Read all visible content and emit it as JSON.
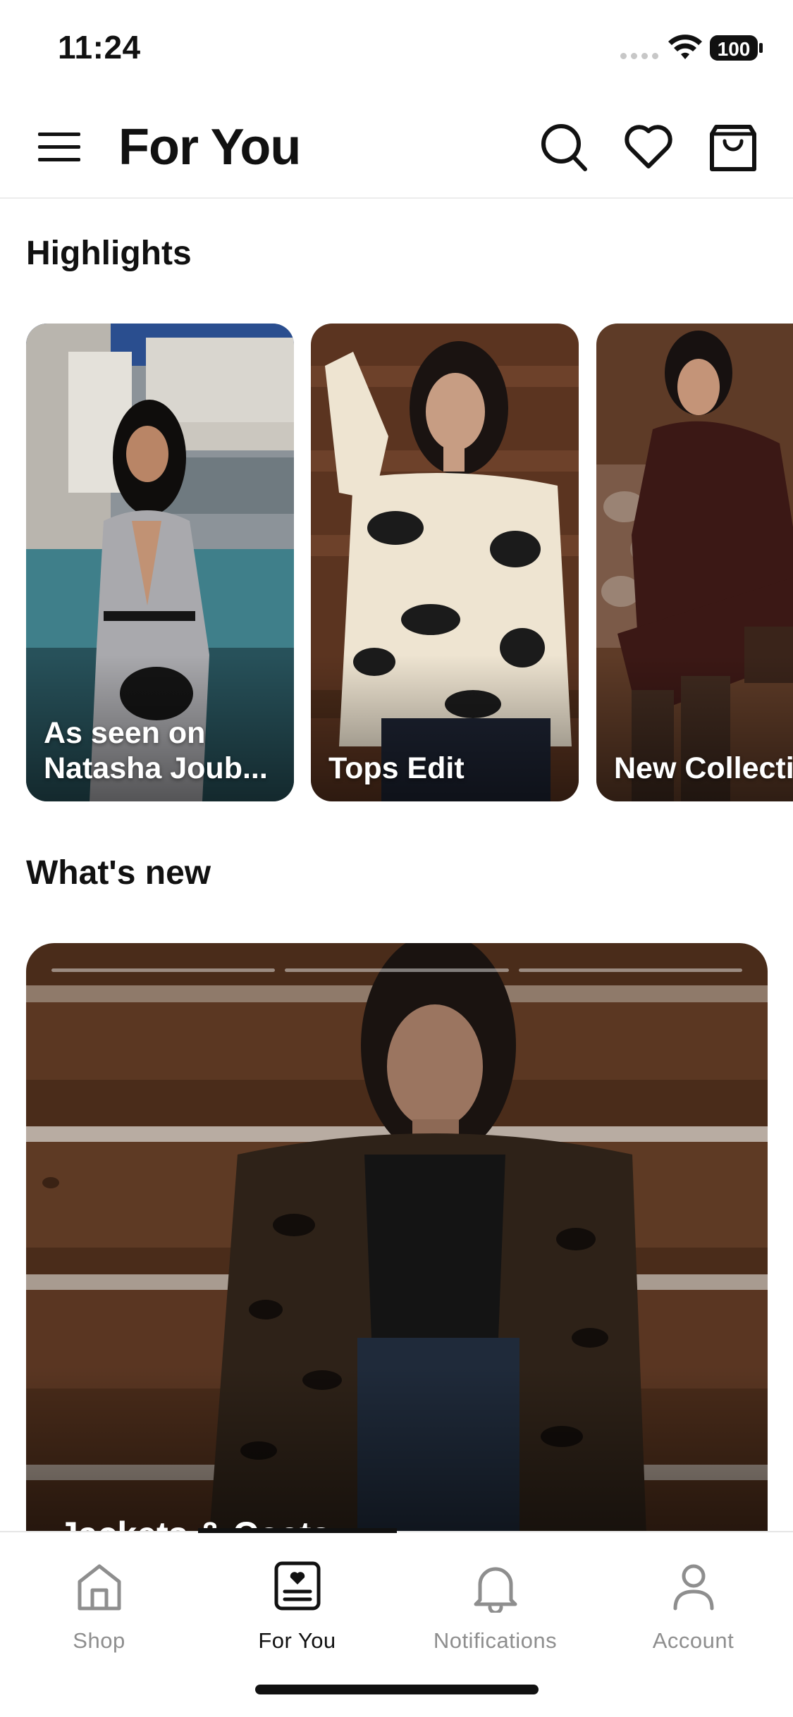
{
  "status_bar": {
    "time": "11:24",
    "battery": "100"
  },
  "header": {
    "title": "For You"
  },
  "highlights": {
    "title": "Highlights",
    "items": [
      {
        "label": "As seen on\nNatasha Joub..."
      },
      {
        "label": "Tops Edit"
      },
      {
        "label": "New Collecti"
      }
    ]
  },
  "whats_new": {
    "title": "What's new",
    "story_label": "Jackets & Coats"
  },
  "tabs": [
    {
      "label": "Shop",
      "icon": "home-icon"
    },
    {
      "label": "For You",
      "icon": "for-you-icon",
      "active": true
    },
    {
      "label": "Notifications",
      "icon": "bell-icon"
    },
    {
      "label": "Account",
      "icon": "person-icon"
    }
  ],
  "colors": {
    "text": "#111111",
    "inactive": "#8e8e8e",
    "divider": "#ececec"
  }
}
